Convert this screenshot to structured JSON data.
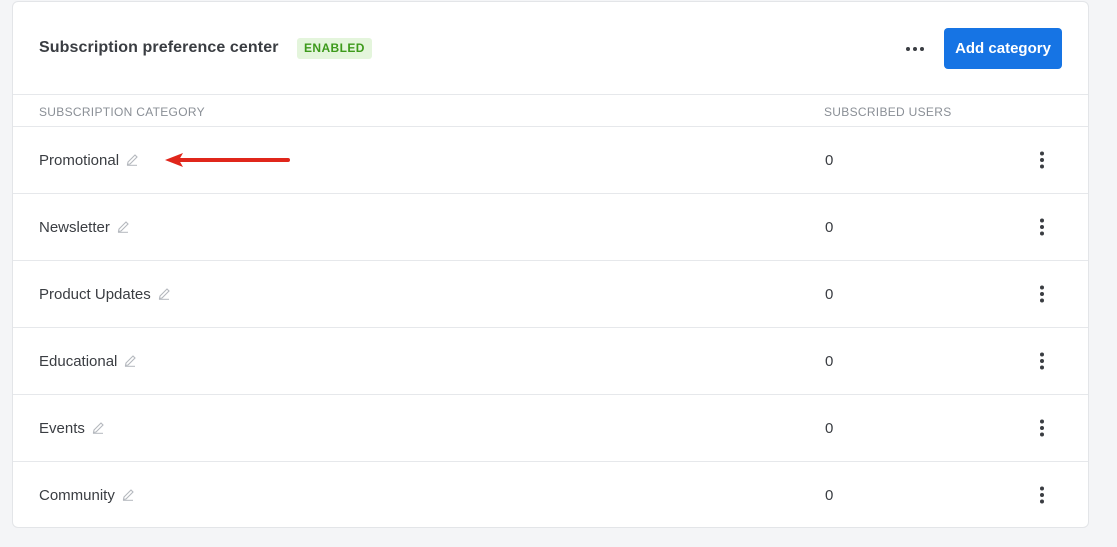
{
  "header": {
    "title": "Subscription preference center",
    "status_badge": "ENABLED",
    "more_icon": "more-horizontal-icon",
    "add_button_label": "Add category"
  },
  "table": {
    "columns": [
      "SUBSCRIPTION CATEGORY",
      "SUBSCRIBED USERS"
    ],
    "rows": [
      {
        "category": "Promotional",
        "subscribed": "0"
      },
      {
        "category": "Newsletter",
        "subscribed": "0"
      },
      {
        "category": "Product Updates",
        "subscribed": "0"
      },
      {
        "category": "Educational",
        "subscribed": "0"
      },
      {
        "category": "Events",
        "subscribed": "0"
      },
      {
        "category": "Community",
        "subscribed": "0"
      }
    ],
    "row_icons": [
      "pencil-edit-icon",
      "more-vertical-icon"
    ]
  },
  "annotation": {
    "type": "red-arrow",
    "points_to": "Promotional edit icon",
    "color": "#e0261b"
  },
  "colors": {
    "accent": "#1674e4",
    "badge_bg": "#e4f5dc",
    "badge_text": "#3d9a1b",
    "page_bg": "#f4f5f7"
  }
}
